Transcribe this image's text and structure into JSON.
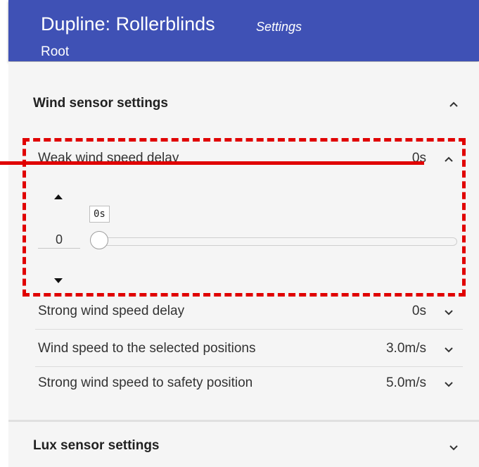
{
  "header": {
    "title": "Dupline: Rollerblinds",
    "settings_label": "Settings",
    "breadcrumb": "Root",
    "background_color": "#3f51b5"
  },
  "wind_section": {
    "title": "Wind sensor settings",
    "toggle_icon": "chevron-up-icon",
    "expanded_item": {
      "label": "Weak wind speed delay",
      "value": "0s",
      "input_value": "0",
      "slider_tooltip": "0s",
      "slider_fraction": 0,
      "up_icon": "triangle-up-icon",
      "down_icon": "triangle-down-icon"
    },
    "items": [
      {
        "label": "Strong wind speed delay",
        "value": "0s"
      },
      {
        "label": "Wind speed to the selected positions",
        "value": "3.0m/s"
      },
      {
        "label": "Strong wind speed to safety position",
        "value": "5.0m/s"
      }
    ]
  },
  "lux_section": {
    "title": "Lux sensor settings",
    "toggle_icon": "chevron-down-icon"
  },
  "annotation": {
    "color": "#e00000"
  }
}
